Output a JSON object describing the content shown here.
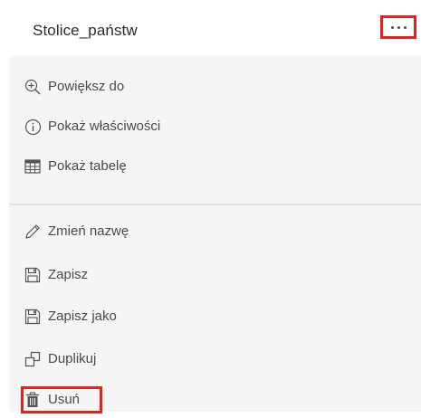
{
  "layer": {
    "title": "Stolice_państw",
    "more_icon": "ellipsis-icon"
  },
  "menu": {
    "group1": [
      {
        "label": "Powiększ do",
        "icon": "zoom-in-icon"
      },
      {
        "label": "Pokaż właściwości",
        "icon": "info-icon"
      },
      {
        "label": "Pokaż tabelę",
        "icon": "table-icon"
      }
    ],
    "group2": [
      {
        "label": "Zmień nazwę",
        "icon": "pencil-icon"
      },
      {
        "label": "Zapisz",
        "icon": "save-icon"
      },
      {
        "label": "Zapisz jako",
        "icon": "save-as-icon"
      },
      {
        "label": "Duplikuj",
        "icon": "duplicate-icon"
      },
      {
        "label": "Usuń",
        "icon": "trash-icon"
      }
    ]
  },
  "colors": {
    "highlight": "#e0231c",
    "menu_background": "#f5f5f5",
    "icon": "#555555"
  }
}
